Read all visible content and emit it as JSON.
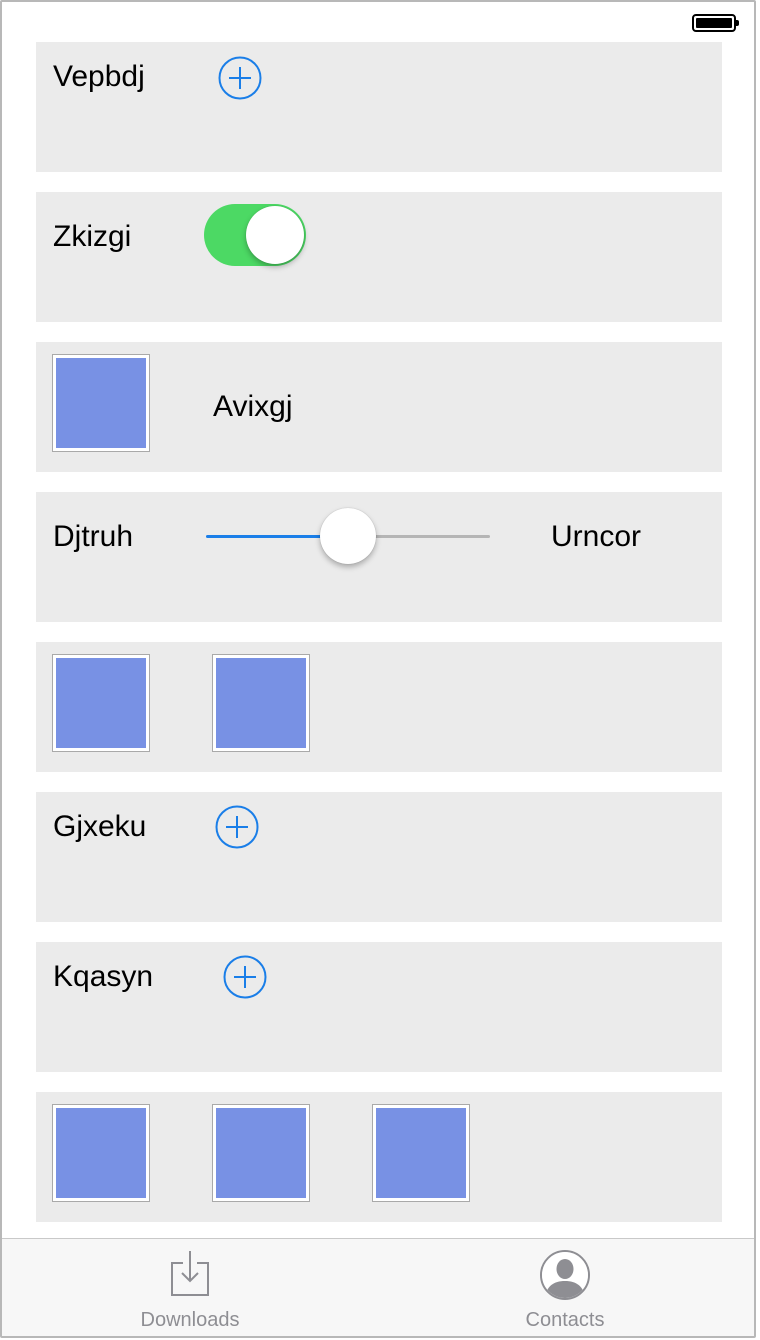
{
  "status_bar": {
    "battery_icon": "battery-full-icon"
  },
  "rows": [
    {
      "type": "label-add",
      "label": "Vepbdj",
      "icon": "add-circle-icon"
    },
    {
      "type": "label-toggle",
      "label": "Zkizgi",
      "toggle_on": true
    },
    {
      "type": "image-label",
      "label": "Avixgj",
      "image": "image-thumbnail"
    },
    {
      "type": "slider",
      "label_left": "Djtruh",
      "label_right": "Urncor",
      "slider_value": 0.5
    },
    {
      "type": "images",
      "image_count": 2
    },
    {
      "type": "label-add",
      "label": "Gjxeku",
      "icon": "add-circle-icon"
    },
    {
      "type": "label-add",
      "label": "Kqasyn",
      "icon": "add-circle-icon"
    },
    {
      "type": "images",
      "image_count": 3
    }
  ],
  "tab_bar": {
    "tabs": [
      {
        "label": "Downloads",
        "icon": "downloads-icon"
      },
      {
        "label": "Contacts",
        "icon": "contacts-icon"
      }
    ]
  },
  "colors": {
    "accent": "#1a7ee8",
    "toggle_on": "#4cd964",
    "row_background": "#ebebeb",
    "thumbnail_fill": "#7891e4",
    "tab_label": "#8e8e93"
  }
}
